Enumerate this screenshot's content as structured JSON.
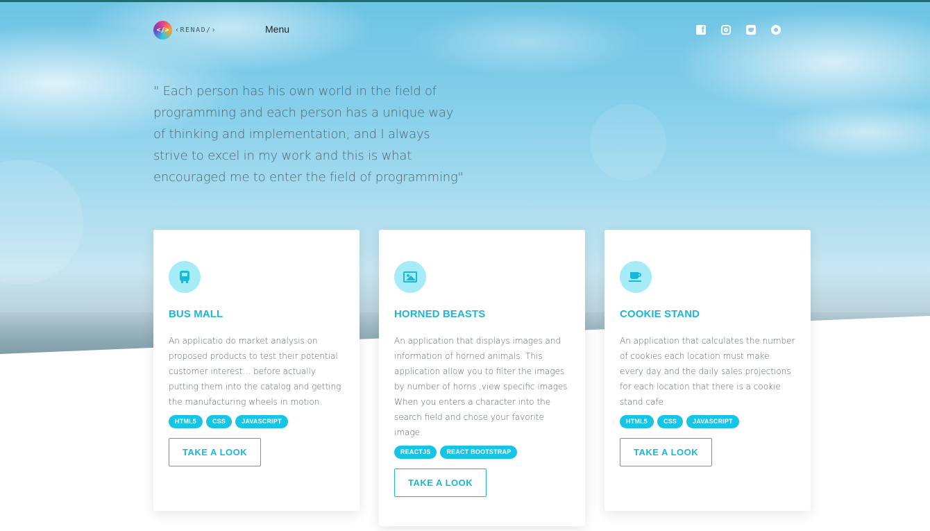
{
  "header": {
    "logo_text": "‹RENAD/›",
    "logo_badge": "</>",
    "menu_label": "Menu",
    "social_icons": [
      "facebook-icon",
      "instagram-icon",
      "twitter-icon",
      "github-icon"
    ]
  },
  "hero": {
    "quote": "\" Each person has his own world in the field of programming and each person has a unique way of thinking and implementation, and I always strive to excel in my work and this is what encouraged me to enter the field of programming\""
  },
  "projects": [
    {
      "icon": "bus-icon",
      "title": "BUS MALL",
      "description": "An applicatio do market analysis on proposed products to test their potential customer interest… before actually putting them into the catalog and getting the manufacturing wheels in motion.",
      "tags": [
        "HTML5",
        "CSS",
        "JAVASCRIPT"
      ],
      "button": "TAKE A LOOK"
    },
    {
      "icon": "image-icon",
      "title": "HORNED BEASTS",
      "description": "An application that displays images and information of horned animals. This application allow you to filter the images by number of horns ,view specific images When you enters a character into the search field and chose your favorite image.",
      "tags": [
        "REACTJS",
        "REACT BOOTSTRAP"
      ],
      "button": "TAKE A LOOK"
    },
    {
      "icon": "coffee-cup-icon",
      "title": "COOKIE STAND",
      "description": "An application that calculates the number of cookies each location must make every day and the daily sales projections for each location that there is a cookie stand cafe",
      "tags": [
        "HTML5",
        "CSS",
        "JAVASCRIPT"
      ],
      "button": "TAKE A LOOK"
    }
  ],
  "colors": {
    "accent": "#16c4e6",
    "icon_bg": "#a5ecf7",
    "quote_text": "#4e6570"
  }
}
